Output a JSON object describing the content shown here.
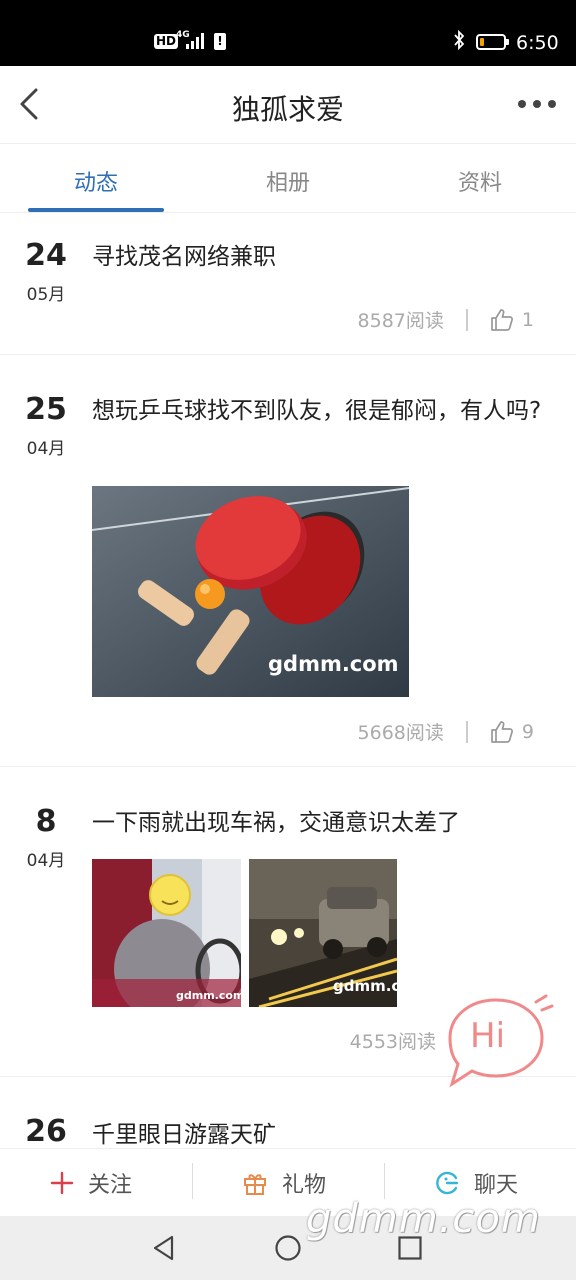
{
  "status_bar": {
    "hd": "HD",
    "network": "4G",
    "time": "6:50",
    "battery_level": 0.15
  },
  "header": {
    "title": "独孤求爱"
  },
  "tabs": [
    {
      "label": "动态",
      "active": true
    },
    {
      "label": "相册",
      "active": false
    },
    {
      "label": "资料",
      "active": false
    }
  ],
  "posts": [
    {
      "day": "24",
      "month": "05月",
      "text": "寻找茂名网络兼职",
      "reads": "8587阅读",
      "likes": "1"
    },
    {
      "day": "25",
      "month": "04月",
      "text": "想玩乒乓球找不到队友，很是郁闷，有人吗?",
      "reads": "5668阅读",
      "likes": "9",
      "image_watermark": "gdmm.com"
    },
    {
      "day": "8",
      "month": "04月",
      "text": "一下雨就出现车祸，交通意识太差了",
      "reads": "4553阅读",
      "image_watermarks": [
        "gdmm.com",
        "gdmm.co"
      ]
    },
    {
      "day": "26",
      "text": "千里眼日游露天矿"
    }
  ],
  "hi_bubble": {
    "label": "Hi",
    "color": "#f08a8a"
  },
  "bottom_bar": {
    "follow_label": "关注",
    "gift_label": "礼物",
    "chat_label": "聊天"
  },
  "watermark": "gdmm.com",
  "colors": {
    "accent": "#2f6fb5",
    "follow_icon": "#d9404a",
    "gift_icon": "#e88a4a",
    "chat_icon": "#36b5d8"
  },
  "icons": [
    "back-arrow-icon",
    "more-dots-icon",
    "thumbs-up-icon",
    "plus-icon",
    "gift-icon",
    "chat-icon",
    "nav-back-icon",
    "nav-home-icon",
    "nav-recents-icon"
  ]
}
